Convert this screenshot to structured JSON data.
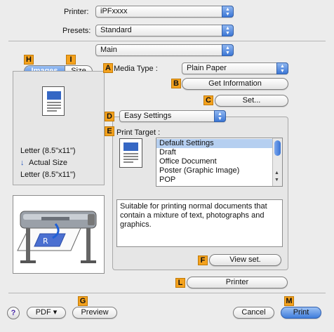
{
  "top": {
    "printer_label": "Printer:",
    "printer_value": "iPFxxxx",
    "presets_label": "Presets:",
    "presets_value": "Standard",
    "pane_value": "Main"
  },
  "badges": {
    "a": "A",
    "b": "B",
    "c": "C",
    "d": "D",
    "e": "E",
    "f": "F",
    "g": "G",
    "h": "H",
    "i": "I",
    "l": "L",
    "m": "M"
  },
  "tabs": {
    "images": "Images",
    "size": "Size"
  },
  "preview": {
    "line1": "Letter (8.5\"x11\")",
    "actual_arrow": "↓",
    "actual_label": "Actual Size",
    "line2": "Letter (8.5\"x11\")"
  },
  "media": {
    "label": "Media Type :",
    "value": "Plain Paper",
    "get_info": "Get Information",
    "set": "Set..."
  },
  "settings": {
    "mode": "Easy Settings",
    "print_target_label": "Print Target :",
    "targets": [
      "Default Settings",
      "Draft",
      "Office Document",
      "Poster (Graphic Image)",
      "POP"
    ],
    "selected_index": 0,
    "description": "Suitable for printing normal documents that contain a mixture of text, photographs and graphics.",
    "view_set": "View set."
  },
  "printer_btn": "Printer",
  "bottom": {
    "help": "?",
    "pdf": "PDF ▾",
    "preview": "Preview",
    "cancel": "Cancel",
    "print": "Print"
  },
  "colors": {
    "accent": "#3c77d6",
    "badge": "#f4a21e"
  }
}
